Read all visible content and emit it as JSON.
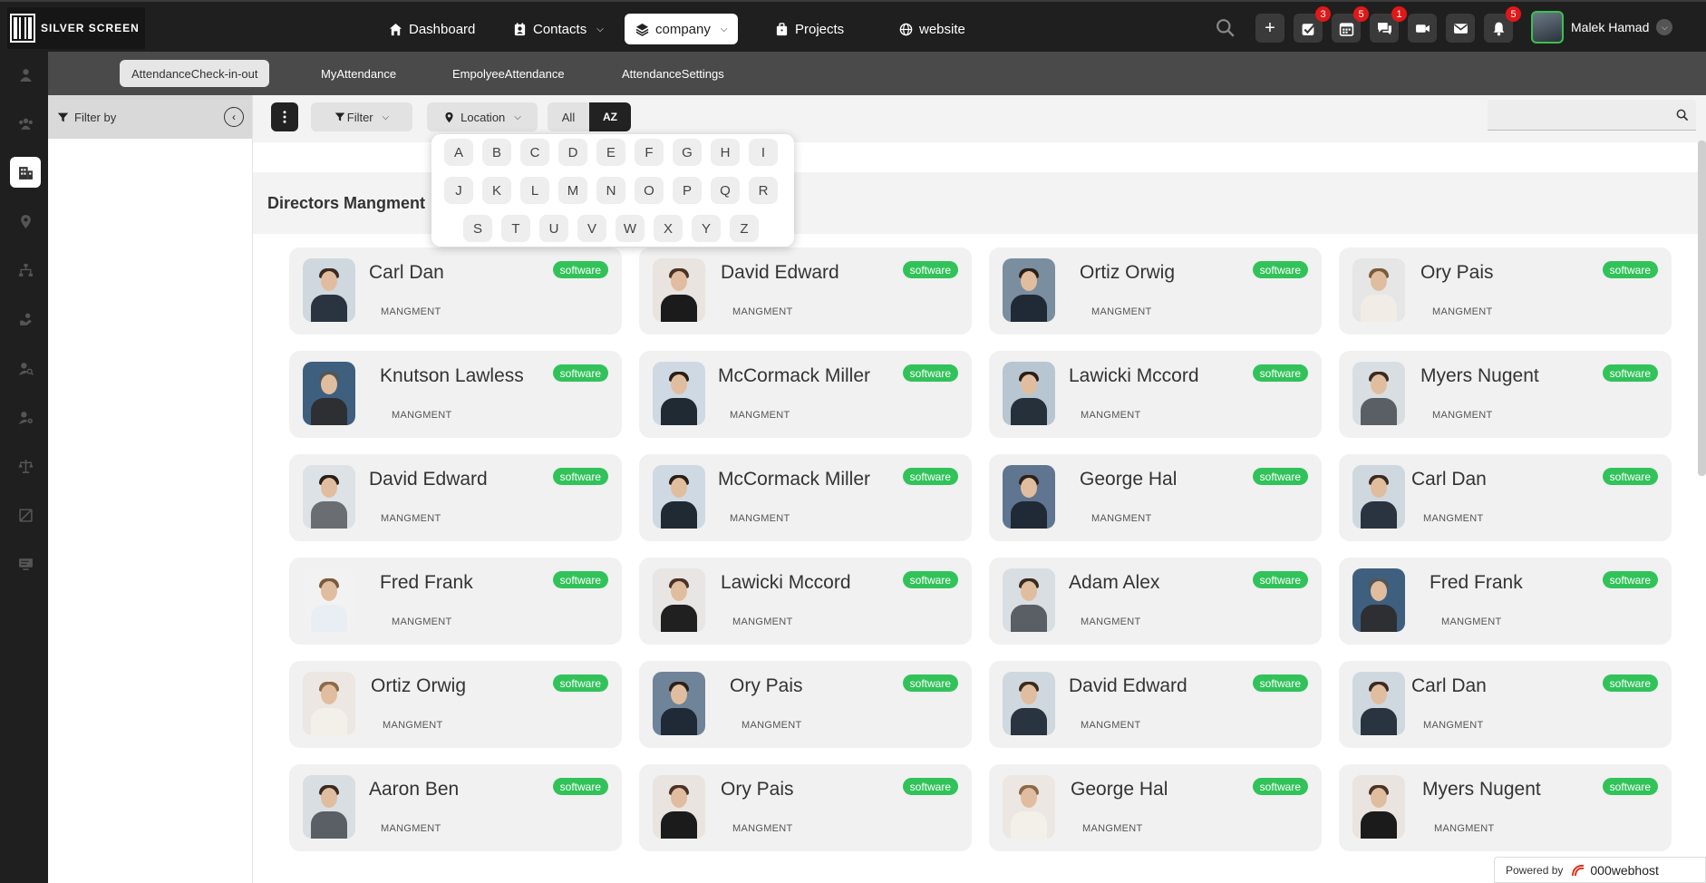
{
  "app": {
    "logo_text": "SILVER SCREEN"
  },
  "topnav": [
    {
      "label": "Dashboard",
      "icon": "home-icon",
      "has_dropdown": false
    },
    {
      "label": "Contacts",
      "icon": "contacts-icon",
      "has_dropdown": true
    },
    {
      "label": "company",
      "icon": "layers-icon",
      "has_dropdown": true,
      "active": true
    },
    {
      "label": "Projects",
      "icon": "briefcase-icon",
      "has_dropdown": false
    },
    {
      "label": "website",
      "icon": "globe-icon",
      "has_dropdown": false
    }
  ],
  "top_actions": {
    "add": "+",
    "tasks_badge": "3",
    "calendar_badge": "5",
    "chat_badge": "1",
    "notifications_badge": "5"
  },
  "user": {
    "name": "Malek Hamad"
  },
  "subtabs": [
    "AttendanceCheck-in-out",
    "MyAttendance",
    "EmpolyeeAttendance",
    "AttendanceSettings"
  ],
  "filter_panel": {
    "title": "Filter by"
  },
  "toolbar": {
    "filter_label": "Filter",
    "location_label": "Location",
    "all_label": "All",
    "az_label": "AZ"
  },
  "search": {
    "placeholder": "",
    "value": ""
  },
  "alphabet": {
    "row1": [
      "A",
      "B",
      "C",
      "D",
      "E",
      "F",
      "G",
      "H",
      "I"
    ],
    "row2": [
      "J",
      "K",
      "L",
      "M",
      "N",
      "O",
      "P",
      "Q",
      "R"
    ],
    "row3": [
      "S",
      "T",
      "U",
      "V",
      "W",
      "X",
      "Y",
      "Z"
    ]
  },
  "section_title": "Directors Mangment",
  "cards": [
    {
      "name": "Carl Dan",
      "role": "MANGMENT",
      "tag": "software"
    },
    {
      "name": "David Edward",
      "role": "MANGMENT",
      "tag": "software"
    },
    {
      "name": "Ortiz Orwig",
      "role": "MANGMENT",
      "tag": "software"
    },
    {
      "name": "Ory Pais",
      "role": "MANGMENT",
      "tag": "software"
    },
    {
      "name": "Knutson Lawless",
      "role": "MANGMENT",
      "tag": "software"
    },
    {
      "name": "McCormack Miller",
      "role": "MANGMENT",
      "tag": "software"
    },
    {
      "name": "Lawicki Mccord",
      "role": "MANGMENT",
      "tag": "software"
    },
    {
      "name": "Myers Nugent",
      "role": "MANGMENT",
      "tag": "software"
    },
    {
      "name": "David Edward",
      "role": "MANGMENT",
      "tag": "software"
    },
    {
      "name": "McCormack Miller",
      "role": "MANGMENT",
      "tag": "software"
    },
    {
      "name": "George Hal",
      "role": "MANGMENT",
      "tag": "software"
    },
    {
      "name": "Carl Dan",
      "role": "MANGMENT",
      "tag": "software"
    },
    {
      "name": "Fred Frank",
      "role": "MANGMENT",
      "tag": "software"
    },
    {
      "name": "Lawicki Mccord",
      "role": "MANGMENT",
      "tag": "software"
    },
    {
      "name": "Adam Alex",
      "role": "MANGMENT",
      "tag": "software"
    },
    {
      "name": "Fred Frank",
      "role": "MANGMENT",
      "tag": "software"
    },
    {
      "name": "Ortiz Orwig",
      "role": "MANGMENT",
      "tag": "software"
    },
    {
      "name": "Ory Pais",
      "role": "MANGMENT",
      "tag": "software"
    },
    {
      "name": "David Edward",
      "role": "MANGMENT",
      "tag": "software"
    },
    {
      "name": "Carl Dan",
      "role": "MANGMENT",
      "tag": "software"
    },
    {
      "name": "Aaron Ben",
      "role": "MANGMENT",
      "tag": "software"
    },
    {
      "name": "Ory Pais",
      "role": "MANGMENT",
      "tag": "software"
    },
    {
      "name": "George Hal",
      "role": "MANGMENT",
      "tag": "software"
    },
    {
      "name": "Myers Nugent",
      "role": "MANGMENT",
      "tag": "software"
    }
  ],
  "footer": {
    "powered_by": "Powered by",
    "brand": "000webhost"
  },
  "colors": {
    "tag_green": "#32c25a",
    "badge_red": "#e01818",
    "topbar": "#1f1f1f"
  }
}
